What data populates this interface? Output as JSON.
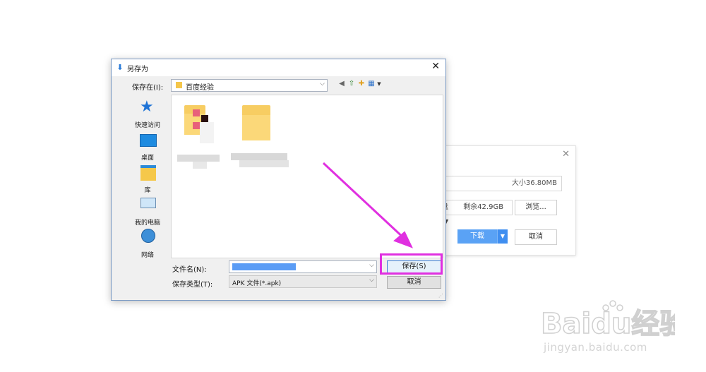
{
  "background_dialog": {
    "close_icon": "close-icon",
    "size_text": "大小36.80MB",
    "drive_prefix": "盘",
    "drive_free": "剩余42.9GB",
    "browse_label": "浏览...",
    "download_label": "下载",
    "cancel_label": "取消"
  },
  "save_dialog": {
    "title": "另存为",
    "title_icon": "download-icon",
    "save_in_label": "保存在(I):",
    "save_in_value": "百度经验",
    "places": [
      {
        "label": "快速访问",
        "icon": "star-icon"
      },
      {
        "label": "桌面",
        "icon": "desktop-icon"
      },
      {
        "label": "库",
        "icon": "library-icon"
      },
      {
        "label": "我的电脑",
        "icon": "computer-icon"
      },
      {
        "label": "网络",
        "icon": "network-icon"
      }
    ],
    "filename_label": "文件名(N):",
    "filename_value": "",
    "filetype_label": "保存类型(T):",
    "filetype_value": "APK 文件(*.apk)",
    "save_button": "保存(S)",
    "cancel_button": "取消"
  },
  "colors": {
    "highlight": "#e030e0",
    "accent": "#5aa2f5"
  },
  "watermark": {
    "brand": "Baidu经验",
    "url": "jingyan.baidu.com"
  }
}
